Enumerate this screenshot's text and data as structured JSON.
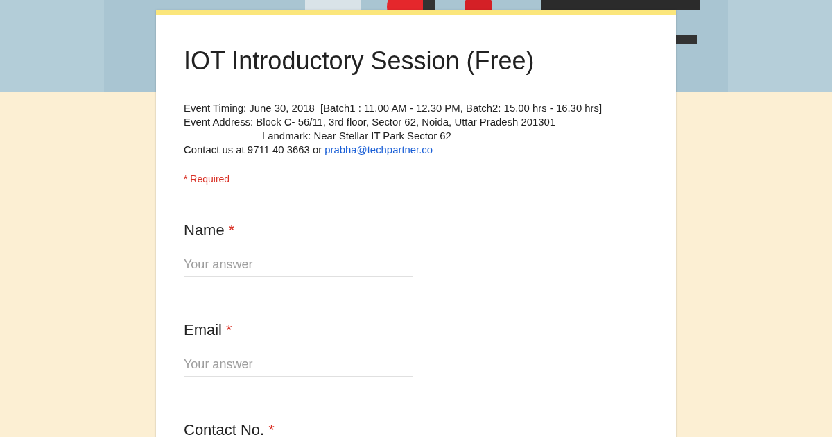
{
  "form": {
    "title": "IOT Introductory Session (Free)",
    "description": [
      {
        "text": "Event Timing: June 30, 2018  [Batch1 : 11.00 AM - 12.30 PM, Batch2: 15.00 hrs - 16.30 hrs]"
      },
      {
        "text": "Event Address: Block C- 56/11, 3rd floor, Sector 62, Noida, Uttar Pradesh 201301",
        "continuation": "Landmark: Near Stellar IT Park Sector 62"
      },
      {
        "text": "Contact us at 9711 40 3663 or",
        "link": "prabha@techpartner.co"
      }
    ],
    "required_note": "* Required",
    "questions": [
      {
        "label": "Name",
        "required_mark": "*",
        "placeholder": "Your answer"
      },
      {
        "label": "Email",
        "required_mark": "*",
        "placeholder": "Your answer"
      },
      {
        "label": "Contact No.",
        "required_mark": "*"
      }
    ]
  }
}
